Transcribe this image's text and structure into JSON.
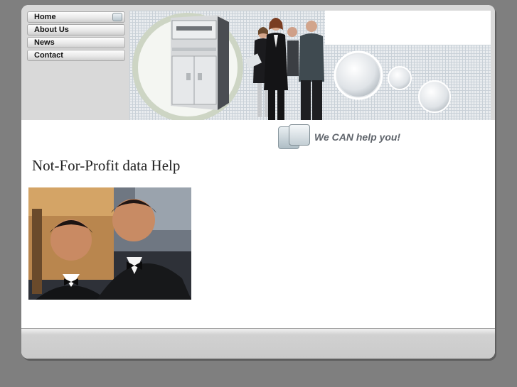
{
  "nav": {
    "items": [
      {
        "label": "Home"
      },
      {
        "label": "About Us"
      },
      {
        "label": "News"
      },
      {
        "label": "Contact"
      }
    ]
  },
  "main": {
    "tagline": "We CAN help you!",
    "heading": "Not-For-Profit data Help"
  },
  "colors": {
    "page_background": "#7f7f7f",
    "frame": "#c9c9c9",
    "content_background": "#ffffff",
    "tagline_text": "#5f646b"
  }
}
